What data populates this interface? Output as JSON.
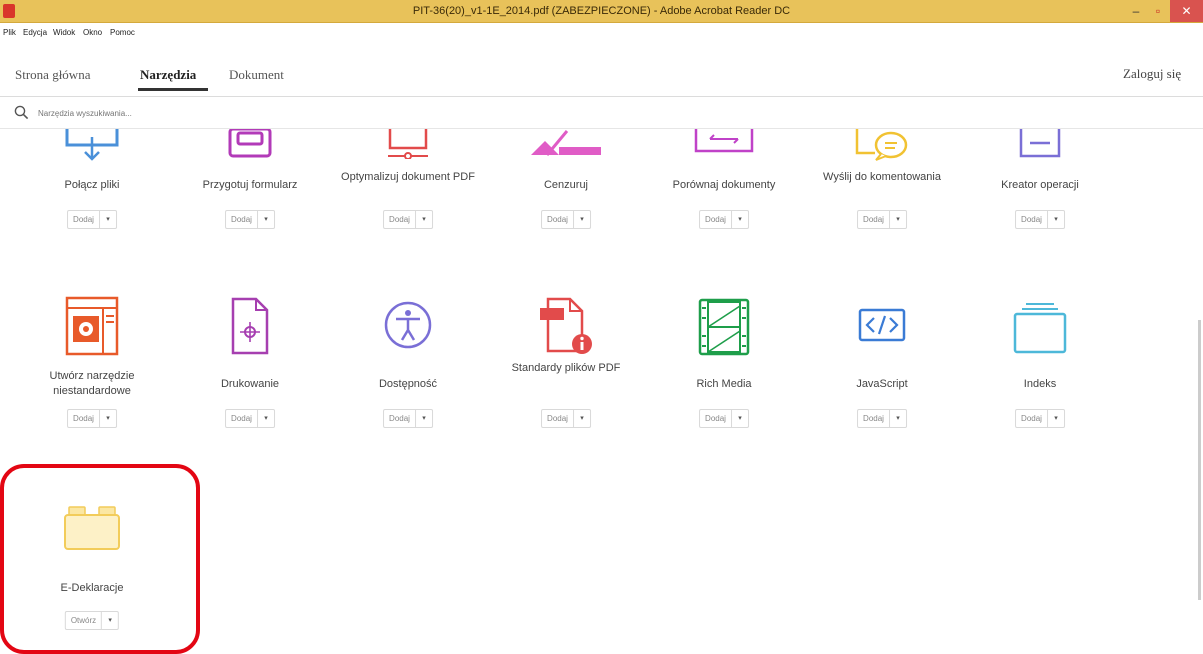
{
  "window": {
    "title": "PIT-36(20)_v1-1E_2014.pdf (ZABEZPIECZONE) - Adobe Acrobat Reader DC",
    "min": "–",
    "max": "▫",
    "close": "✕"
  },
  "menu": [
    "Plik",
    "Edycja",
    "Widok",
    "Okno",
    "Pomoc"
  ],
  "tabs": [
    "Strona główna",
    "Narzędzia",
    "Dokument"
  ],
  "login": "Zaloguj się",
  "search": {
    "placeholder": "Narzędzia wyszukiwania..."
  },
  "colors": {
    "accent_red": "#e30613",
    "titlebar": "#e8c25a"
  },
  "tools": [
    {
      "name": "Połącz pliki",
      "button": "Dodaj",
      "icon": "combine-files-icon"
    },
    {
      "name": "Przygotuj formularz",
      "button": "Dodaj",
      "icon": "prepare-form-icon"
    },
    {
      "name": "Optymalizuj dokument PDF",
      "button": "Dodaj",
      "icon": "optimize-pdf-icon"
    },
    {
      "name": "Cenzuruj",
      "button": "Dodaj",
      "icon": "redact-icon"
    },
    {
      "name": "Porównaj dokumenty",
      "button": "Dodaj",
      "icon": "compare-icon"
    },
    {
      "name": "Wyślij do komentowania",
      "button": "Dodaj",
      "icon": "send-comments-icon"
    },
    {
      "name": "Kreator operacji",
      "button": "Dodaj",
      "icon": "action-wizard-icon"
    },
    {
      "name": "Utwórz narzędzie niestandardowe",
      "button": "Dodaj",
      "icon": "custom-tool-icon"
    },
    {
      "name": "Drukowanie",
      "button": "Dodaj",
      "icon": "print-production-icon"
    },
    {
      "name": "Dostępność",
      "button": "Dodaj",
      "icon": "accessibility-icon"
    },
    {
      "name": "Standardy plików PDF",
      "button": "Dodaj",
      "icon": "pdf-standards-icon"
    },
    {
      "name": "Rich Media",
      "button": "Dodaj",
      "icon": "rich-media-icon"
    },
    {
      "name": "JavaScript",
      "button": "Dodaj",
      "icon": "javascript-icon"
    },
    {
      "name": "Indeks",
      "button": "Dodaj",
      "icon": "index-icon"
    },
    {
      "name": "E-Deklaracje",
      "button": "Otwórz",
      "icon": "e-deklaracje-icon"
    }
  ]
}
